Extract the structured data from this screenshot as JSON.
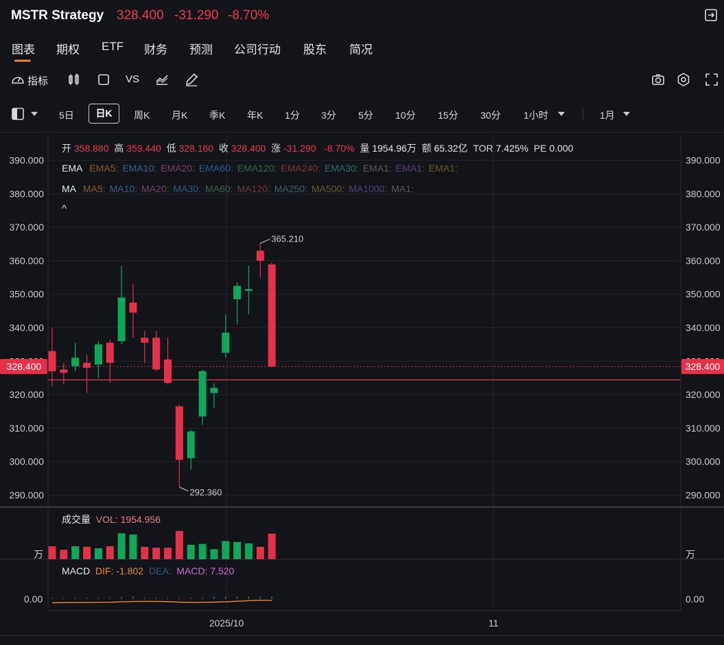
{
  "header": {
    "symbol": "MSTR Strategy",
    "last_price": "328.400",
    "change": "-31.290",
    "change_pct": "-8.70%"
  },
  "tabs": [
    {
      "label": "图表"
    },
    {
      "label": "期权"
    },
    {
      "label": "ETF"
    },
    {
      "label": "财务"
    },
    {
      "label": "预测"
    },
    {
      "label": "公司行动"
    },
    {
      "label": "股东"
    },
    {
      "label": "简况"
    }
  ],
  "toolbar": {
    "indicator_label": "指标",
    "vs_label": "VS"
  },
  "periods": [
    {
      "label": "5日"
    },
    {
      "label": "日K"
    },
    {
      "label": "周K"
    },
    {
      "label": "月K"
    },
    {
      "label": "季K"
    },
    {
      "label": "年K"
    },
    {
      "label": "1分"
    },
    {
      "label": "3分"
    },
    {
      "label": "5分"
    },
    {
      "label": "10分"
    },
    {
      "label": "15分"
    },
    {
      "label": "30分"
    },
    {
      "label": "1小时"
    },
    {
      "label": "1月"
    }
  ],
  "info": {
    "open_label": "开",
    "open": "358.880",
    "high_label": "高",
    "high": "359.440",
    "low_label": "低",
    "low": "328.160",
    "close_label": "收",
    "close": "328.400",
    "chg_label": "涨",
    "chg": "-31.290",
    "chg_pct": "-8.70%",
    "vol_label": "量",
    "vol": "1954.96万",
    "amount_label": "额",
    "amount": "65.32亿",
    "tor_label": "TOR",
    "tor": "7.425%",
    "pe_label": "PE",
    "pe": "0.000"
  },
  "ema_row": {
    "title": "EMA",
    "items": [
      {
        "label": "EMA5:",
        "color": "#8a5a2a"
      },
      {
        "label": "EMA10:",
        "color": "#3a5f8f"
      },
      {
        "label": "EMA20:",
        "color": "#7a3f6a"
      },
      {
        "label": "EMA60:",
        "color": "#2f5a8f"
      },
      {
        "label": "EMA120:",
        "color": "#2f6a4a"
      },
      {
        "label": "EMA240:",
        "color": "#7a3636"
      },
      {
        "label": "EMA30:",
        "color": "#2f6a6a"
      },
      {
        "label": "EMA1:",
        "color": "#5a5a5a"
      },
      {
        "label": "EMA1:",
        "color": "#5a3f7a"
      },
      {
        "label": "EMA1:",
        "color": "#6a5a2a"
      }
    ]
  },
  "ma_row": {
    "title": "MA",
    "items": [
      {
        "label": "MA5:",
        "color": "#8a5a2a"
      },
      {
        "label": "MA10:",
        "color": "#3a5f8f"
      },
      {
        "label": "MA20:",
        "color": "#7a3f6a"
      },
      {
        "label": "MA30:",
        "color": "#2f5a8f"
      },
      {
        "label": "MA60:",
        "color": "#2f6a4a"
      },
      {
        "label": "MA120:",
        "color": "#7a3636"
      },
      {
        "label": "MA250:",
        "color": "#2f6a6a"
      },
      {
        "label": "MA500:",
        "color": "#6a5a2a"
      },
      {
        "label": "MA1000:",
        "color": "#5a3f7a"
      },
      {
        "label": "MA1:",
        "color": "#5a5a5a"
      }
    ]
  },
  "collapse_glyph": "^",
  "volume_panel": {
    "title": "成交量",
    "value_label": "VOL: 1954.956",
    "unit": "万"
  },
  "macd_panel": {
    "title": "MACD",
    "dif_label": "DIF: -1.802",
    "dea_label": "DEA:",
    "macd_label": "MACD: 7.520",
    "zero_label": "0.00"
  },
  "colors": {
    "up": "#0fa85b",
    "down": "#e5304a",
    "accent": "#ef7d2b"
  },
  "chart_data": {
    "type": "candlestick",
    "y_ticks": [
      "390.000",
      "380.000",
      "370.000",
      "360.000",
      "350.000",
      "340.000",
      "330.000",
      "320.000",
      "310.000",
      "300.000",
      "290.000"
    ],
    "ylim": [
      286.2,
      397.5
    ],
    "x_ticks": [
      "2025/10",
      "11"
    ],
    "last_price_label": "328.400",
    "high_marker": "365.210",
    "low_marker": "292.360",
    "reference_line": 324.4,
    "candles": [
      {
        "o": 333.0,
        "h": 340.0,
        "l": 322.5,
        "c": 327.0,
        "dir": "down"
      },
      {
        "o": 327.5,
        "h": 329.5,
        "l": 323.0,
        "c": 326.5,
        "dir": "down"
      },
      {
        "o": 328.5,
        "h": 335.5,
        "l": 327.0,
        "c": 331.0,
        "dir": "up"
      },
      {
        "o": 329.5,
        "h": 332.0,
        "l": 320.5,
        "c": 328.0,
        "dir": "down"
      },
      {
        "o": 329.0,
        "h": 336.0,
        "l": 325.0,
        "c": 335.0,
        "dir": "up"
      },
      {
        "o": 335.5,
        "h": 336.5,
        "l": 323.5,
        "c": 329.5,
        "dir": "down"
      },
      {
        "o": 336.0,
        "h": 358.5,
        "l": 335.0,
        "c": 349.0,
        "dir": "up"
      },
      {
        "o": 347.5,
        "h": 353.0,
        "l": 337.0,
        "c": 344.5,
        "dir": "down"
      },
      {
        "o": 337.0,
        "h": 339.0,
        "l": 329.5,
        "c": 335.5,
        "dir": "down"
      },
      {
        "o": 337.0,
        "h": 339.0,
        "l": 327.0,
        "c": 327.5,
        "dir": "down"
      },
      {
        "o": 330.5,
        "h": 337.0,
        "l": 323.0,
        "c": 323.5,
        "dir": "down"
      },
      {
        "o": 316.5,
        "h": 317.0,
        "l": 292.4,
        "c": 300.5,
        "dir": "down"
      },
      {
        "o": 301.0,
        "h": 309.5,
        "l": 297.5,
        "c": 309.0,
        "dir": "up"
      },
      {
        "o": 313.5,
        "h": 327.5,
        "l": 311.0,
        "c": 327.0,
        "dir": "up"
      },
      {
        "o": 320.5,
        "h": 323.5,
        "l": 316.0,
        "c": 322.0,
        "dir": "up"
      },
      {
        "o": 332.5,
        "h": 344.0,
        "l": 331.0,
        "c": 338.5,
        "dir": "up"
      },
      {
        "o": 348.5,
        "h": 353.5,
        "l": 341.0,
        "c": 352.5,
        "dir": "up"
      },
      {
        "o": 351.5,
        "h": 358.5,
        "l": 344.0,
        "c": 351.0,
        "dir": "up"
      },
      {
        "o": 363.0,
        "h": 365.2,
        "l": 355.0,
        "c": 360.0,
        "dir": "down"
      },
      {
        "o": 358.9,
        "h": 359.4,
        "l": 328.2,
        "c": 328.4,
        "dir": "down"
      }
    ],
    "volume": [
      {
        "v": 0.45,
        "dir": "down"
      },
      {
        "v": 0.33,
        "dir": "down"
      },
      {
        "v": 0.45,
        "dir": "up"
      },
      {
        "v": 0.43,
        "dir": "down"
      },
      {
        "v": 0.38,
        "dir": "up"
      },
      {
        "v": 0.45,
        "dir": "down"
      },
      {
        "v": 0.9,
        "dir": "up"
      },
      {
        "v": 0.86,
        "dir": "up"
      },
      {
        "v": 0.43,
        "dir": "down"
      },
      {
        "v": 0.4,
        "dir": "down"
      },
      {
        "v": 0.4,
        "dir": "down"
      },
      {
        "v": 0.98,
        "dir": "down"
      },
      {
        "v": 0.5,
        "dir": "up"
      },
      {
        "v": 0.53,
        "dir": "up"
      },
      {
        "v": 0.35,
        "dir": "up"
      },
      {
        "v": 0.63,
        "dir": "up"
      },
      {
        "v": 0.6,
        "dir": "up"
      },
      {
        "v": 0.55,
        "dir": "up"
      },
      {
        "v": 0.43,
        "dir": "down"
      },
      {
        "v": 0.89,
        "dir": "down"
      }
    ],
    "macd_dif": [
      -1.6,
      -1.5,
      -1.4,
      -1.3,
      -1.2,
      -1.1,
      -0.7,
      -0.4,
      -0.3,
      -0.3,
      -0.5,
      -1.0,
      -1.3,
      -1.2,
      -1.0,
      -0.7,
      -0.1,
      0.4,
      0.8,
      0.6
    ]
  }
}
